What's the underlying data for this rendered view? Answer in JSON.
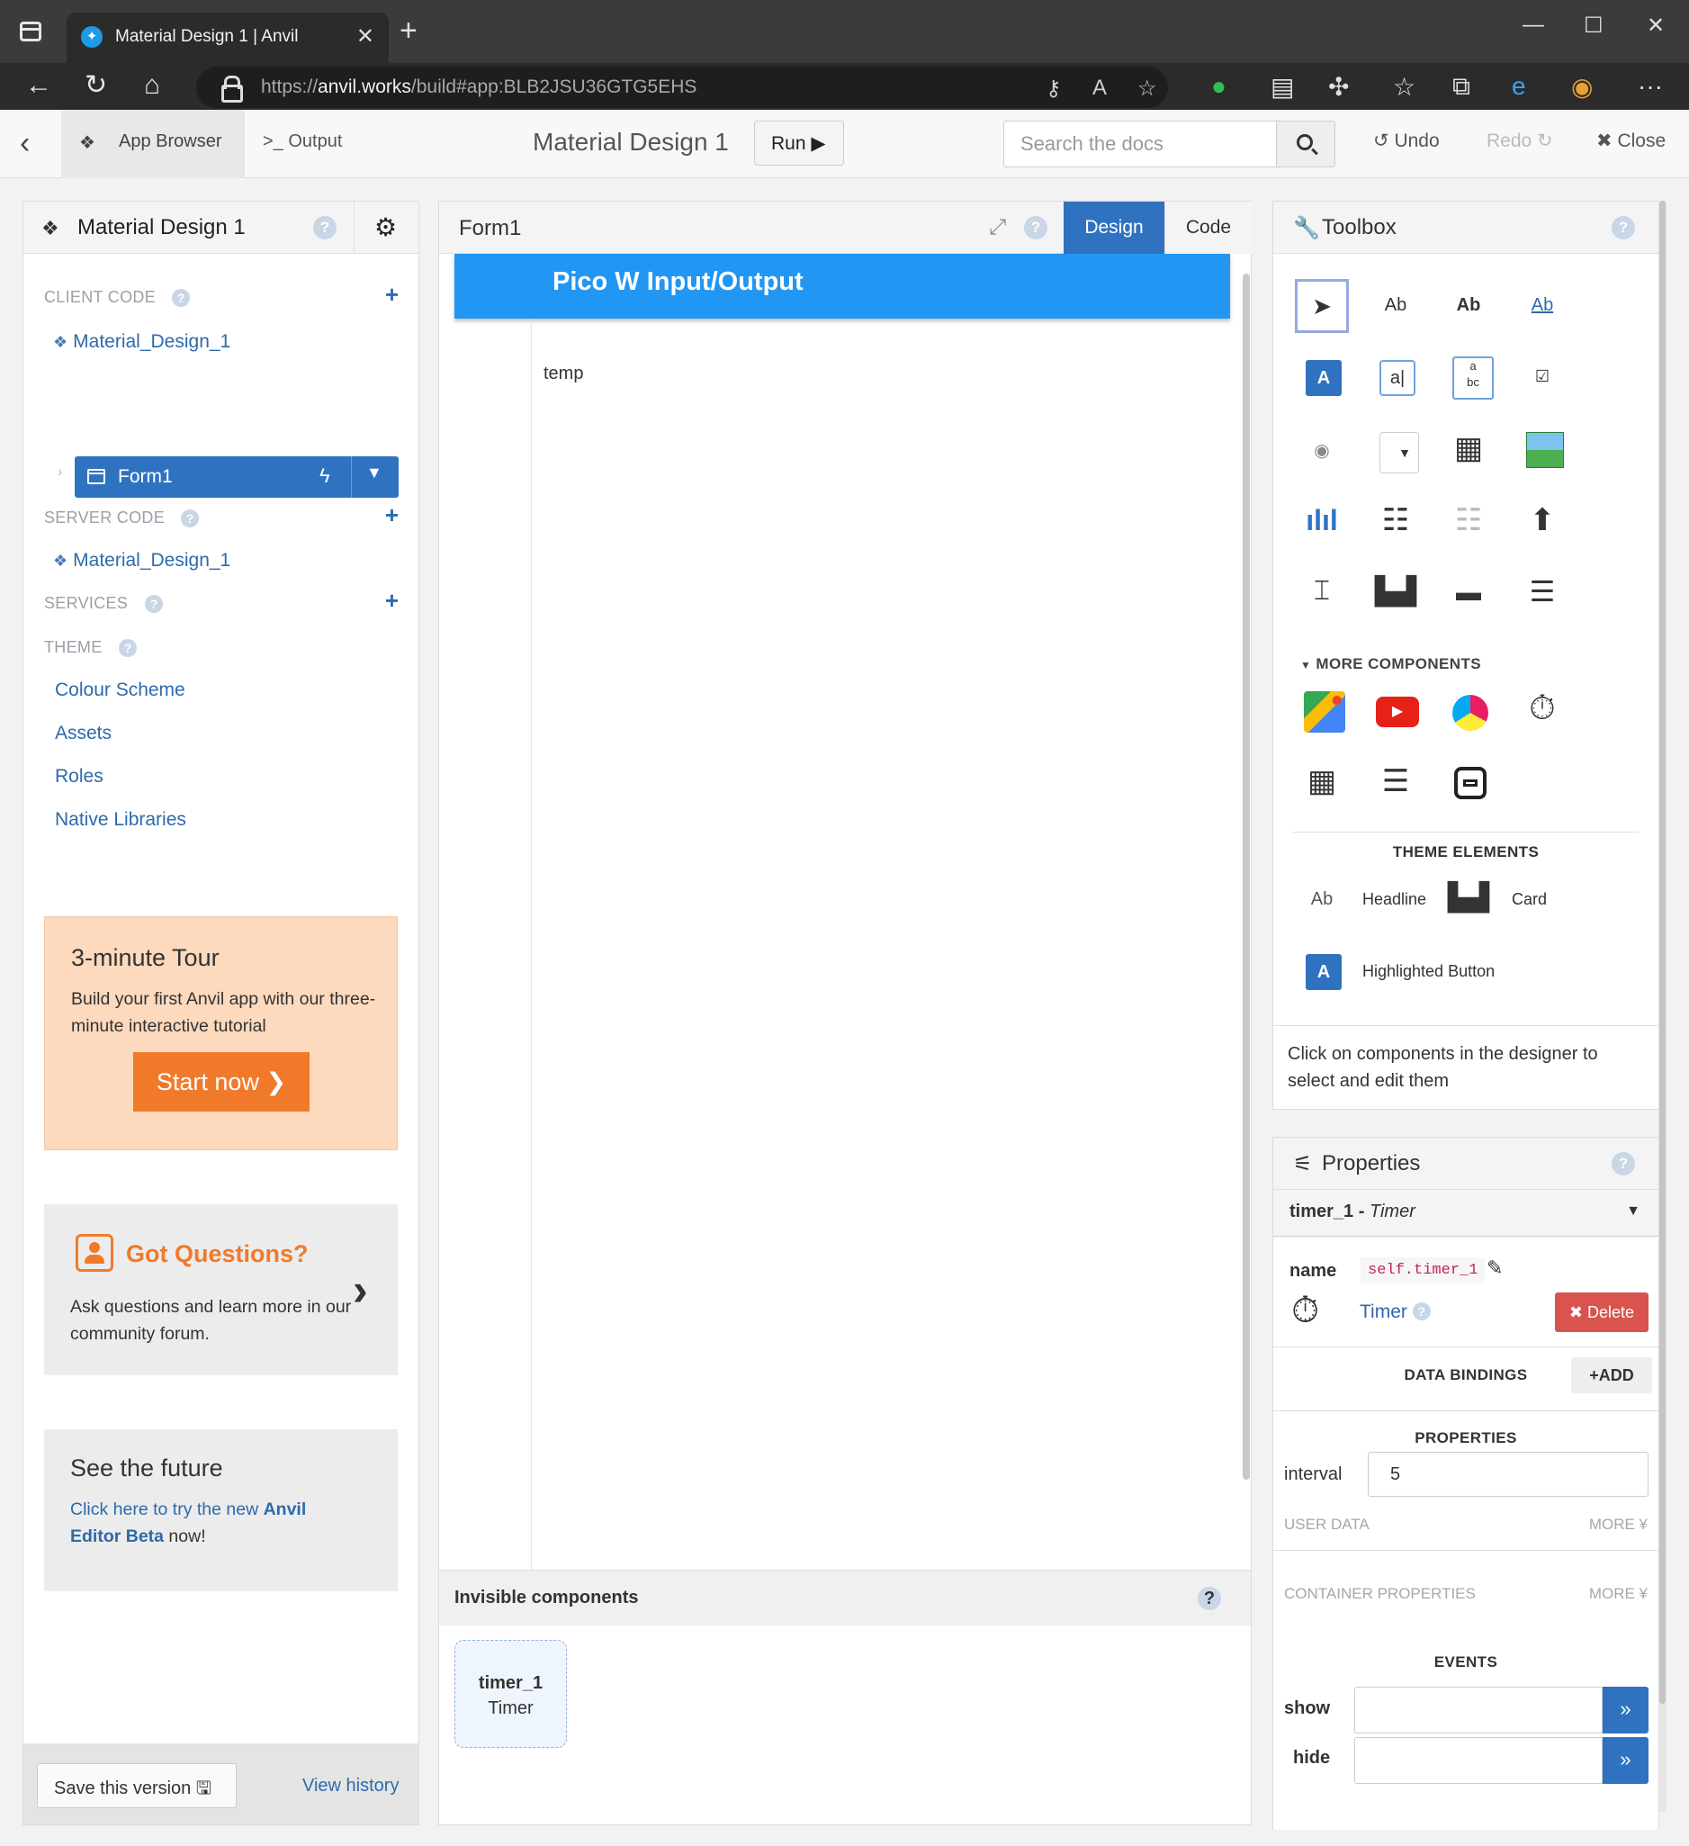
{
  "browser": {
    "tab_title": "Material Design 1 | Anvil",
    "url_prefix": "https://",
    "url_host": "anvil.works",
    "url_path": "/build#app:BLB2JSU36GTG5EHS"
  },
  "topbar": {
    "app_browser": "App Browser",
    "output": "Output",
    "project_title": "Material Design 1",
    "run": "Run",
    "search_placeholder": "Search the docs",
    "undo": "Undo",
    "redo": "Redo",
    "close": "Close"
  },
  "sidebar": {
    "title": "Material Design 1",
    "client_code": "CLIENT CODE",
    "client_module": "Material_Design_1",
    "form": "Form1",
    "server_code": "SERVER CODE",
    "server_module": "Material_Design_1",
    "services": "SERVICES",
    "theme": "THEME",
    "theme_items": [
      "Colour Scheme",
      "Assets",
      "Roles",
      "Native Libraries"
    ],
    "tour": {
      "title": "3-minute Tour",
      "desc": "Build your first Anvil app with our three-minute interactive tutorial",
      "button": "Start now"
    },
    "questions": {
      "title": "Got Questions?",
      "desc": "Ask questions and learn more in our community forum."
    },
    "future": {
      "title": "See the future",
      "link_a": "Click here to try the new ",
      "link_b": "Anvil Editor Beta",
      "tail": " now!"
    },
    "save": "Save this version",
    "history": "View history"
  },
  "designer": {
    "form_title": "Form1",
    "tab_design": "Design",
    "tab_code": "Code",
    "app_title": "Pico W Input/Output",
    "label_text": "temp",
    "invisible_header": "Invisible components",
    "invisible_name": "timer_1",
    "invisible_type": "Timer"
  },
  "toolbox": {
    "title": "Toolbox",
    "more_components": "MORE COMPONENTS",
    "theme_elements": "THEME ELEMENTS",
    "headline": "Headline",
    "card": "Card",
    "highlighted_button": "Highlighted Button",
    "hint": "Click on components in the designer to select and edit them",
    "tools": [
      "pointer-icon",
      "label-icon",
      "bold-label-icon",
      "link-icon",
      "button-icon",
      "textbox-icon",
      "textarea-icon",
      "checkbox-icon",
      "radio-icon",
      "dropdown-icon",
      "datepicker-icon",
      "image-icon",
      "plot-icon",
      "datagrid-icon",
      "repeating-panel-icon",
      "fileloader-icon",
      "spacer-icon",
      "gridpanel-icon",
      "flowpanel-icon",
      "columnpanel-icon",
      "google-map-icon",
      "youtube-icon",
      "canvas-icon",
      "timer-icon",
      "xypanel-icon",
      "linearpanel-icon",
      "rich-text-icon"
    ]
  },
  "properties": {
    "title": "Properties",
    "component_name": "timer_1",
    "component_type": "Timer",
    "name_label": "name",
    "name_value": "self.timer_1",
    "type_link": "Timer",
    "delete": "Delete",
    "data_bindings": "DATA BINDINGS",
    "add": "ADD",
    "props_header": "PROPERTIES",
    "interval_label": "interval",
    "interval_value": "5",
    "user_data": "USER DATA",
    "container_properties": "CONTAINER PROPERTIES",
    "more": "MORE",
    "events": "EVENTS",
    "event_show": "show",
    "event_hide": "hide"
  },
  "colors": {
    "accent": "#2f73c0",
    "appbar": "#2196f3",
    "tour_bg": "#fdd9bd",
    "orange": "#f07a2a",
    "delete": "#d9534f"
  }
}
